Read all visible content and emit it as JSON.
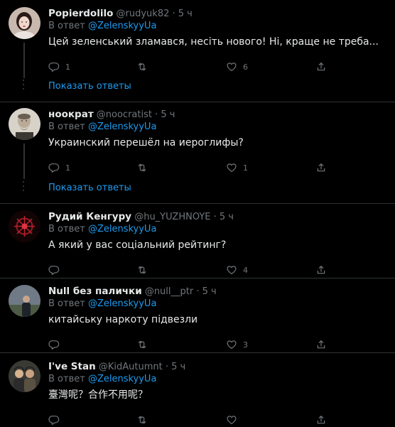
{
  "tweets": [
    {
      "name": "Popierdolilo",
      "handle": "@rudyuk82",
      "time": "· 5 ч",
      "reply_prefix": "В ответ",
      "reply_to": "@ZelenskyyUa",
      "text": "Цей зеленський зламався, несіть нового! Ні, краще не треба...",
      "replies": "1",
      "retweets": "",
      "likes": "6",
      "avatar_icon": "avatar-portrait-woman",
      "show_replies": "Показать ответы"
    },
    {
      "name": "ноократ",
      "handle": "@noocratist",
      "time": "· 5 ч",
      "reply_prefix": "В ответ",
      "reply_to": "@ZelenskyyUa",
      "text": "Украинский перешёл на иероглифы?",
      "replies": "1",
      "retweets": "",
      "likes": "1",
      "avatar_icon": "avatar-bearded-man",
      "show_replies": "Показать ответы"
    },
    {
      "name": "Рудий Кенгуру",
      "handle": "@hu_YUZHNOYE",
      "time": "· 5 ч",
      "reply_prefix": "В ответ",
      "reply_to": "@ZelenskyyUa",
      "text": "А який у вас соціальний рейтинг?",
      "replies": "",
      "retweets": "",
      "likes": "4",
      "avatar_icon": "avatar-red-emblem"
    },
    {
      "name": "Null без палички",
      "handle": "@null__ptr",
      "time": "· 5 ч",
      "reply_prefix": "В ответ",
      "reply_to": "@ZelenskyyUa",
      "text": "китайську наркоту підвезли",
      "replies": "",
      "retweets": "",
      "likes": "3",
      "avatar_icon": "avatar-person-outdoors"
    },
    {
      "name": "I've Stan",
      "handle": "@KidAutumnt",
      "time": "· 5 ч",
      "reply_prefix": "В ответ",
      "reply_to": "@ZelenskyyUa",
      "text": "臺灣呢？合作不用呢？",
      "replies": "",
      "retweets": "",
      "likes": "",
      "avatar_icon": "avatar-two-people"
    }
  ],
  "colors": {
    "background": "#000000",
    "accent": "#1d9bf0",
    "muted": "#71767b",
    "separator": "#2f3336"
  }
}
